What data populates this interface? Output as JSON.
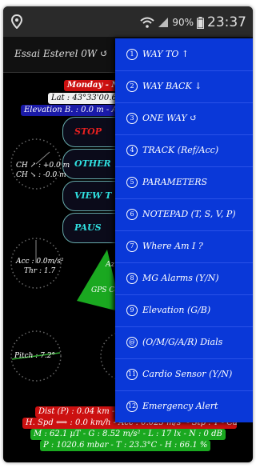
{
  "status_bar": {
    "battery_pct": "90%",
    "time": "23:37",
    "icons": [
      "location-pin-icon",
      "wifi-icon",
      "signal-icon",
      "battery-icon"
    ]
  },
  "app_bar": {
    "title": "Essai Esterel 0W ↺"
  },
  "info": {
    "date": "Monday - Nov",
    "lat": "Lat : 43°33'00.656",
    "elevation": "Elevation B. : 0.0 m - Azi"
  },
  "buttons": {
    "stop": "STOP",
    "other": "OTHER",
    "view": "VIEW T",
    "pause": "PAUS"
  },
  "dials": {
    "ch1": "CH ↗ : +0.0 m",
    "ch2": "CH ↘ : -0.0 m",
    "acc": "Acc : 0.0m/s²",
    "thr": "Thr : 1.7",
    "pitch": "Pitch : 7.2°",
    "az": "Az",
    "gps": "GPS Cou"
  },
  "menu": {
    "items": [
      {
        "num": "1",
        "label": "WAY TO ↑"
      },
      {
        "num": "2",
        "label": "WAY BACK ↓"
      },
      {
        "num": "3",
        "label": "ONE WAY ↺"
      },
      {
        "num": "4",
        "label": "TRACK (Ref/Acc)"
      },
      {
        "num": "5",
        "label": "PARAMETERS"
      },
      {
        "num": "6",
        "label": "NOTEPAD (T, S, V, P)"
      },
      {
        "num": "7",
        "label": "Where Am I ?"
      },
      {
        "num": "8",
        "label": "MG Alarms (Y/N)"
      },
      {
        "num": "9",
        "label": "Elevation (G/B)"
      },
      {
        "num": "@",
        "label": "(O/M/G/A/R) Dials"
      },
      {
        "num": "11",
        "label": "Cardio Sensor (Y/N)"
      },
      {
        "num": "12",
        "label": "Emergency Alert"
      }
    ]
  },
  "footer": {
    "dist": "Dist (P) : 0.04 km - Tr",
    "hspd": "H. Spd ⟺ : 0.0 km/h - Acc : 0.025 m/s² - Stp : T - Cal : 9.5",
    "mag": "M : 62.1 µT - G : 8.52 m/s² - L : 17 lx - N : 0 dB",
    "pressure": "P : 1020.6 mbar - T : 23.3°C - H : 66.1 %"
  },
  "colors": {
    "menu_bg": "#0a38d8",
    "date_bg": "#cc1010",
    "lat_bg": "#f0f0f0",
    "elev_bg": "#1a1aa8",
    "stop": "#e82020",
    "other": "#30e0e0",
    "view": "#30e0e0",
    "pause": "#30e0e0",
    "accent_green": "#1aa820"
  }
}
